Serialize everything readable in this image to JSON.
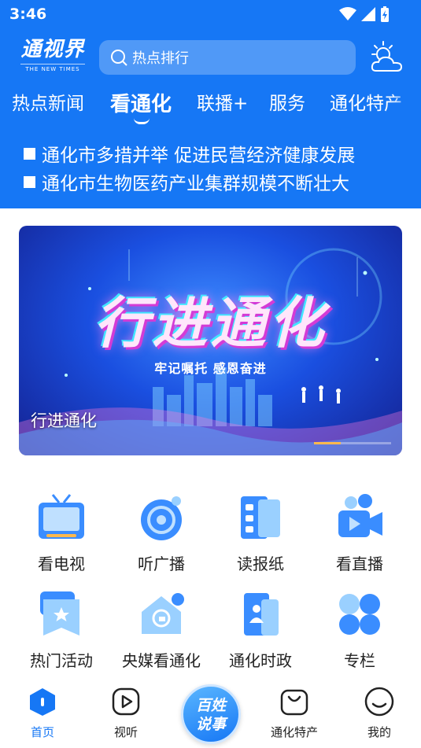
{
  "status_bar": {
    "time": "3:46"
  },
  "header": {
    "logo_text": "通视界",
    "logo_sub": "THE NEW TIMES",
    "search_placeholder": "热点排行",
    "tabs": [
      "热点新闻",
      "看通化",
      "联播+",
      "服务",
      "通化特产"
    ],
    "active_tab": "看通化",
    "headlines": [
      "通化市多措并举 促进民营经济健康发展",
      "通化市生物医药产业集群规模不断壮大"
    ]
  },
  "banner": {
    "title": "行进通化",
    "subtitle": "牢记嘱托 感恩奋进",
    "caption": "行进通化"
  },
  "grid": [
    {
      "label": "看电视",
      "icon": "tv-icon"
    },
    {
      "label": "听广播",
      "icon": "radio-icon"
    },
    {
      "label": "读报纸",
      "icon": "newspaper-icon"
    },
    {
      "label": "看直播",
      "icon": "live-camera-icon"
    },
    {
      "label": "热门活动",
      "icon": "star-badge-icon"
    },
    {
      "label": "央媒看通化",
      "icon": "central-media-icon"
    },
    {
      "label": "通化时政",
      "icon": "politics-icon"
    },
    {
      "label": "专栏",
      "icon": "column-icon"
    }
  ],
  "bottom_nav": {
    "items": [
      {
        "label": "首页",
        "icon": "home-icon",
        "active": true
      },
      {
        "label": "视听",
        "icon": "play-icon",
        "active": false
      },
      {
        "label": "通化特产",
        "icon": "shopping-bag-icon",
        "active": false
      },
      {
        "label": "我的",
        "icon": "smile-icon",
        "active": false
      }
    ],
    "center_button_text_line1": "百姓",
    "center_button_text_line2": "说事"
  },
  "colors": {
    "brand_blue": "#1677f5"
  }
}
